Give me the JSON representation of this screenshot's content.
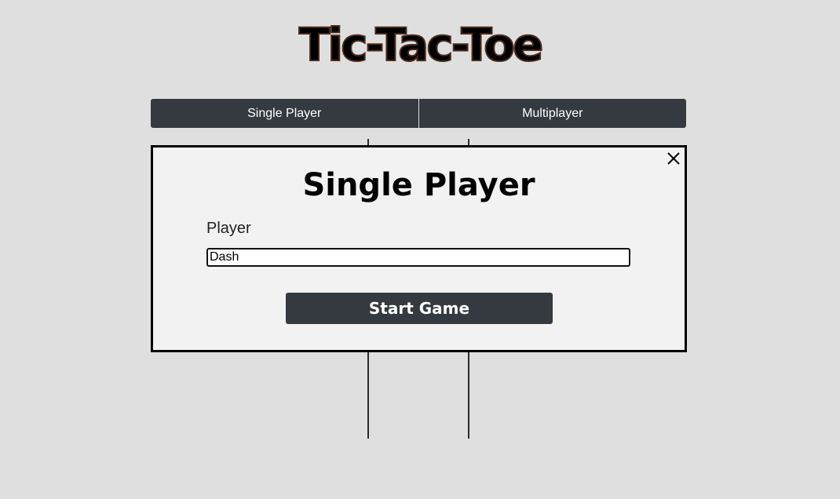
{
  "app": {
    "title": "Tic-Tac-Toe"
  },
  "mode_tabs": [
    {
      "label": "Single Player"
    },
    {
      "label": "Multiplayer"
    }
  ],
  "modal": {
    "title": "Single Player",
    "close_icon": "close-icon",
    "player_label": "Player",
    "player_value": "Dash",
    "start_label": "Start Game"
  },
  "colors": {
    "background": "#dfdfdf",
    "button": "#343a40",
    "modal_bg": "#f2f2f2"
  }
}
